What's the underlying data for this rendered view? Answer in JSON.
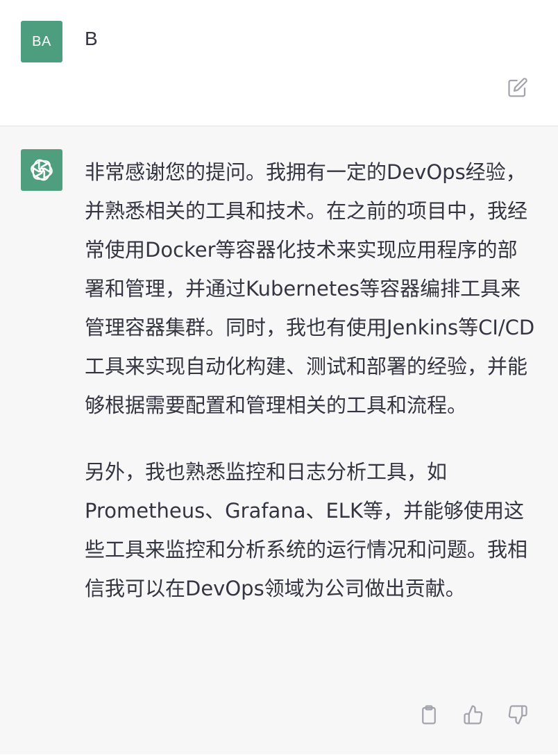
{
  "user_message": {
    "avatar_initials": "BA",
    "avatar_color": "#4d9e7e",
    "text": "B",
    "edit_icon": "edit-icon"
  },
  "assistant_message": {
    "avatar_icon": "openai-logo-icon",
    "avatar_color": "#4f9f7f",
    "paragraphs": [
      "非常感谢您的提问。我拥有一定的DevOps经验，并熟悉相关的工具和技术。在之前的项目中，我经常使用Docker等容器化技术来实现应用程序的部署和管理，并通过Kubernetes等容器编排工具来管理容器集群。同时，我也有使用Jenkins等CI/CD工具来实现自动化构建、测试和部署的经验，并能够根据需要配置和管理相关的工具和流程。",
      "另外，我也熟悉监控和日志分析工具，如Prometheus、Grafana、ELK等，并能够使用这些工具来监控和分析系统的运行情况和问题。我相信我可以在DevOps领域为公司做出贡献。"
    ],
    "actions": {
      "copy_icon": "clipboard-icon",
      "thumbs_up_icon": "thumbs-up-icon",
      "thumbs_down_icon": "thumbs-down-icon"
    }
  }
}
